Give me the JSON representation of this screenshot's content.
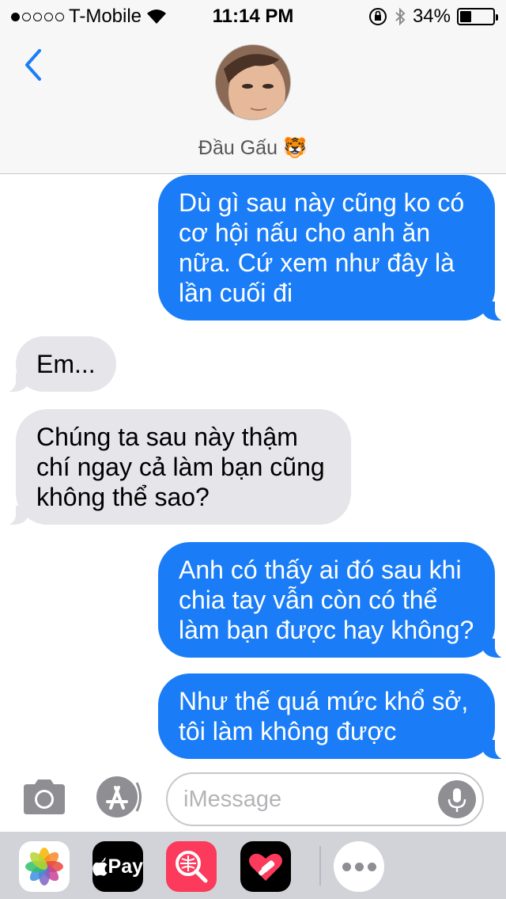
{
  "status_bar": {
    "carrier": "T-Mobile",
    "time": "11:14 PM",
    "battery_percent": "34%",
    "battery_level": 0.34,
    "signal_bars_filled": 1,
    "signal_bars_total": 5,
    "icons": [
      "wifi-icon",
      "orientation-lock-icon",
      "bluetooth-icon",
      "battery-icon"
    ]
  },
  "header": {
    "contact_name": "Đầu Gấu 🐯",
    "back_icon": "chevron-left-icon",
    "accent_color": "#1a7df7"
  },
  "messages": [
    {
      "direction": "sent",
      "text": "Dù gì sau này cũng ko có\ncơ hội nấu cho anh ăn\nnữa. Cứ xem như đây là\nlần cuối đi"
    },
    {
      "direction": "received",
      "text": "Em..."
    },
    {
      "direction": "received",
      "text": "Chúng ta sau này thậm\nchí ngay cả làm bạn cũng\nkhông thể sao?"
    },
    {
      "direction": "sent",
      "text": "Anh có thấy ai đó sau khi\nchia tay vẫn còn có thể\nlàm bạn được hay không?"
    },
    {
      "direction": "sent",
      "text": "Như thế quá mức khổ sở,\ntôi làm không được"
    }
  ],
  "compose": {
    "placeholder": "iMessage",
    "value": "",
    "icons": [
      "camera-icon",
      "app-store-icon",
      "microphone-icon"
    ]
  },
  "drawer": {
    "apps": [
      {
        "name": "photos-app-icon"
      },
      {
        "name": "apple-pay-app-icon",
        "label": "Pay"
      },
      {
        "name": "search-images-app-icon"
      },
      {
        "name": "digital-touch-app-icon"
      },
      {
        "name": "more-apps-icon"
      }
    ]
  },
  "colors": {
    "sent_bubble": "#1a7df7",
    "received_bubble": "#e5e5ea",
    "header_bg": "#f7f7f7",
    "drawer_bg": "#d1d3d9"
  }
}
